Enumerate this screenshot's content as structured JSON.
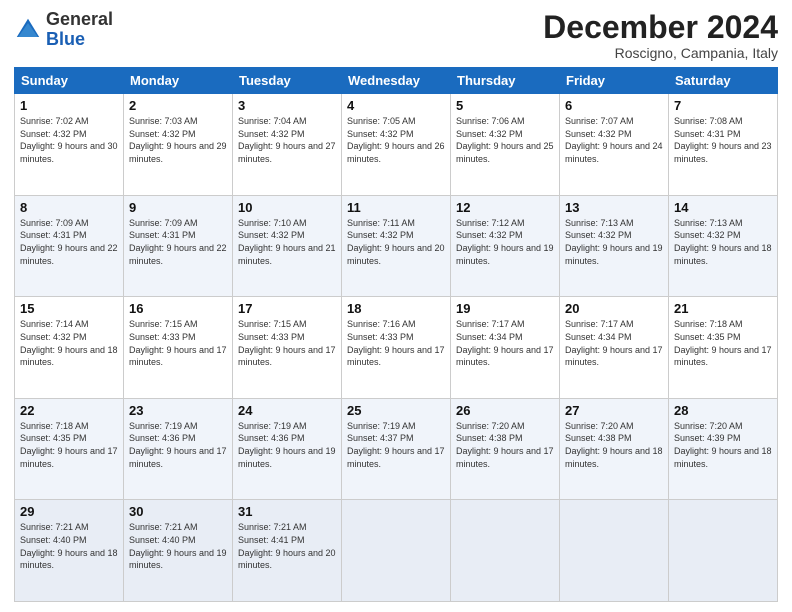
{
  "logo": {
    "general": "General",
    "blue": "Blue"
  },
  "header": {
    "month": "December 2024",
    "location": "Roscigno, Campania, Italy"
  },
  "days_of_week": [
    "Sunday",
    "Monday",
    "Tuesday",
    "Wednesday",
    "Thursday",
    "Friday",
    "Saturday"
  ],
  "weeks": [
    [
      {
        "num": "1",
        "sunrise": "7:02 AM",
        "sunset": "4:32 PM",
        "daylight": "9 hours and 30 minutes."
      },
      {
        "num": "2",
        "sunrise": "7:03 AM",
        "sunset": "4:32 PM",
        "daylight": "9 hours and 29 minutes."
      },
      {
        "num": "3",
        "sunrise": "7:04 AM",
        "sunset": "4:32 PM",
        "daylight": "9 hours and 27 minutes."
      },
      {
        "num": "4",
        "sunrise": "7:05 AM",
        "sunset": "4:32 PM",
        "daylight": "9 hours and 26 minutes."
      },
      {
        "num": "5",
        "sunrise": "7:06 AM",
        "sunset": "4:32 PM",
        "daylight": "9 hours and 25 minutes."
      },
      {
        "num": "6",
        "sunrise": "7:07 AM",
        "sunset": "4:32 PM",
        "daylight": "9 hours and 24 minutes."
      },
      {
        "num": "7",
        "sunrise": "7:08 AM",
        "sunset": "4:31 PM",
        "daylight": "9 hours and 23 minutes."
      }
    ],
    [
      {
        "num": "8",
        "sunrise": "7:09 AM",
        "sunset": "4:31 PM",
        "daylight": "9 hours and 22 minutes."
      },
      {
        "num": "9",
        "sunrise": "7:09 AM",
        "sunset": "4:31 PM",
        "daylight": "9 hours and 22 minutes."
      },
      {
        "num": "10",
        "sunrise": "7:10 AM",
        "sunset": "4:32 PM",
        "daylight": "9 hours and 21 minutes."
      },
      {
        "num": "11",
        "sunrise": "7:11 AM",
        "sunset": "4:32 PM",
        "daylight": "9 hours and 20 minutes."
      },
      {
        "num": "12",
        "sunrise": "7:12 AM",
        "sunset": "4:32 PM",
        "daylight": "9 hours and 19 minutes."
      },
      {
        "num": "13",
        "sunrise": "7:13 AM",
        "sunset": "4:32 PM",
        "daylight": "9 hours and 19 minutes."
      },
      {
        "num": "14",
        "sunrise": "7:13 AM",
        "sunset": "4:32 PM",
        "daylight": "9 hours and 18 minutes."
      }
    ],
    [
      {
        "num": "15",
        "sunrise": "7:14 AM",
        "sunset": "4:32 PM",
        "daylight": "9 hours and 18 minutes."
      },
      {
        "num": "16",
        "sunrise": "7:15 AM",
        "sunset": "4:33 PM",
        "daylight": "9 hours and 17 minutes."
      },
      {
        "num": "17",
        "sunrise": "7:15 AM",
        "sunset": "4:33 PM",
        "daylight": "9 hours and 17 minutes."
      },
      {
        "num": "18",
        "sunrise": "7:16 AM",
        "sunset": "4:33 PM",
        "daylight": "9 hours and 17 minutes."
      },
      {
        "num": "19",
        "sunrise": "7:17 AM",
        "sunset": "4:34 PM",
        "daylight": "9 hours and 17 minutes."
      },
      {
        "num": "20",
        "sunrise": "7:17 AM",
        "sunset": "4:34 PM",
        "daylight": "9 hours and 17 minutes."
      },
      {
        "num": "21",
        "sunrise": "7:18 AM",
        "sunset": "4:35 PM",
        "daylight": "9 hours and 17 minutes."
      }
    ],
    [
      {
        "num": "22",
        "sunrise": "7:18 AM",
        "sunset": "4:35 PM",
        "daylight": "9 hours and 17 minutes."
      },
      {
        "num": "23",
        "sunrise": "7:19 AM",
        "sunset": "4:36 PM",
        "daylight": "9 hours and 17 minutes."
      },
      {
        "num": "24",
        "sunrise": "7:19 AM",
        "sunset": "4:36 PM",
        "daylight": "9 hours and 19 minutes."
      },
      {
        "num": "25",
        "sunrise": "7:19 AM",
        "sunset": "4:37 PM",
        "daylight": "9 hours and 17 minutes."
      },
      {
        "num": "26",
        "sunrise": "7:20 AM",
        "sunset": "4:38 PM",
        "daylight": "9 hours and 17 minutes."
      },
      {
        "num": "27",
        "sunrise": "7:20 AM",
        "sunset": "4:38 PM",
        "daylight": "9 hours and 18 minutes."
      },
      {
        "num": "28",
        "sunrise": "7:20 AM",
        "sunset": "4:39 PM",
        "daylight": "9 hours and 18 minutes."
      }
    ],
    [
      {
        "num": "29",
        "sunrise": "7:21 AM",
        "sunset": "4:40 PM",
        "daylight": "9 hours and 18 minutes."
      },
      {
        "num": "30",
        "sunrise": "7:21 AM",
        "sunset": "4:40 PM",
        "daylight": "9 hours and 19 minutes."
      },
      {
        "num": "31",
        "sunrise": "7:21 AM",
        "sunset": "4:41 PM",
        "daylight": "9 hours and 20 minutes."
      },
      null,
      null,
      null,
      null
    ]
  ],
  "labels": {
    "sunrise": "Sunrise:",
    "sunset": "Sunset:",
    "daylight": "Daylight:"
  }
}
